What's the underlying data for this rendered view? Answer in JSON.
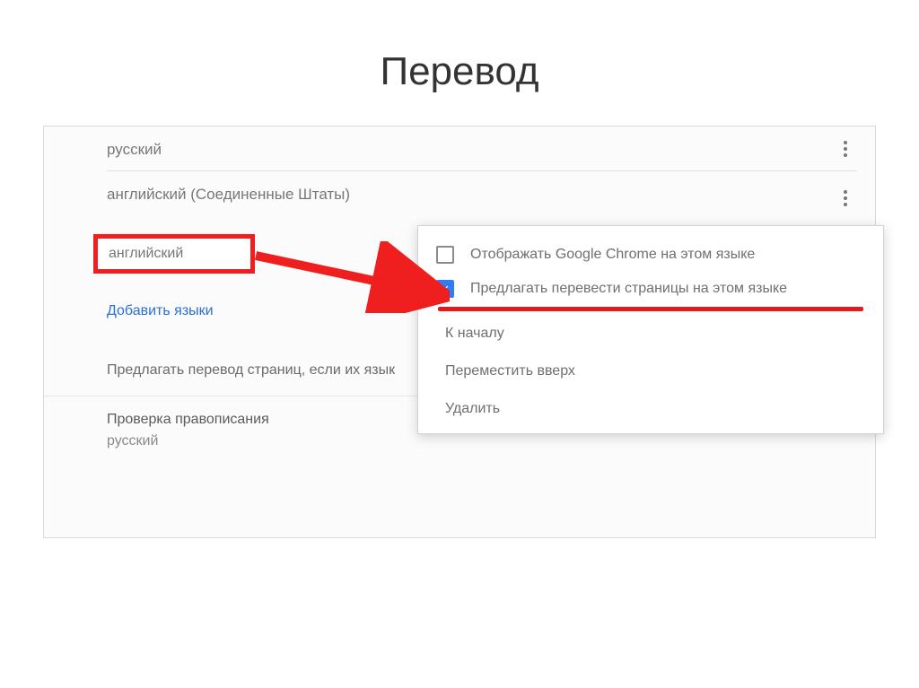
{
  "title": "Перевод",
  "languages": {
    "russian": "русский",
    "english_us": "английский (Соединенные Штаты)",
    "english": "английский"
  },
  "add_link": "Добавить языки",
  "offer_translate_truncated": "Предлагать перевод страниц, если их язык",
  "spellcheck": {
    "title": "Проверка правописания",
    "lang": "русский"
  },
  "menu": {
    "display_chrome": "Отображать Google Chrome на этом языке",
    "offer_translate": "Предлагать перевести страницы на этом языке",
    "to_top": "К началу",
    "move_up": "Переместить вверх",
    "delete": "Удалить"
  },
  "colors": {
    "highlight_red": "#ef1f1f",
    "link_blue": "#2a6fd6",
    "check_blue": "#2f7df4"
  }
}
